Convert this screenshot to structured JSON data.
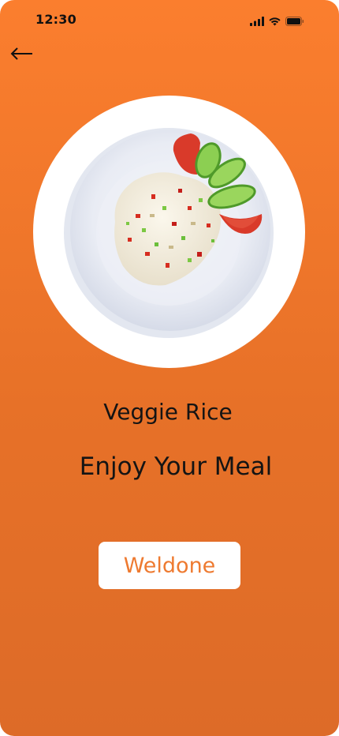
{
  "status_bar": {
    "time": "12:30",
    "icons": [
      "signal-icon",
      "wifi-icon",
      "battery-icon"
    ]
  },
  "nav": {
    "back_icon": "arrow-left-icon"
  },
  "dish": {
    "image": "veggie-rice-plate",
    "title": "Veggie Rice",
    "subtitle": "Enjoy Your Meal"
  },
  "actions": {
    "weldone_label": "Weldone"
  },
  "colors": {
    "background_top": "#fb7e2e",
    "background_bottom": "#dd6b28",
    "button_text": "#ee7a30",
    "text": "#141414"
  }
}
